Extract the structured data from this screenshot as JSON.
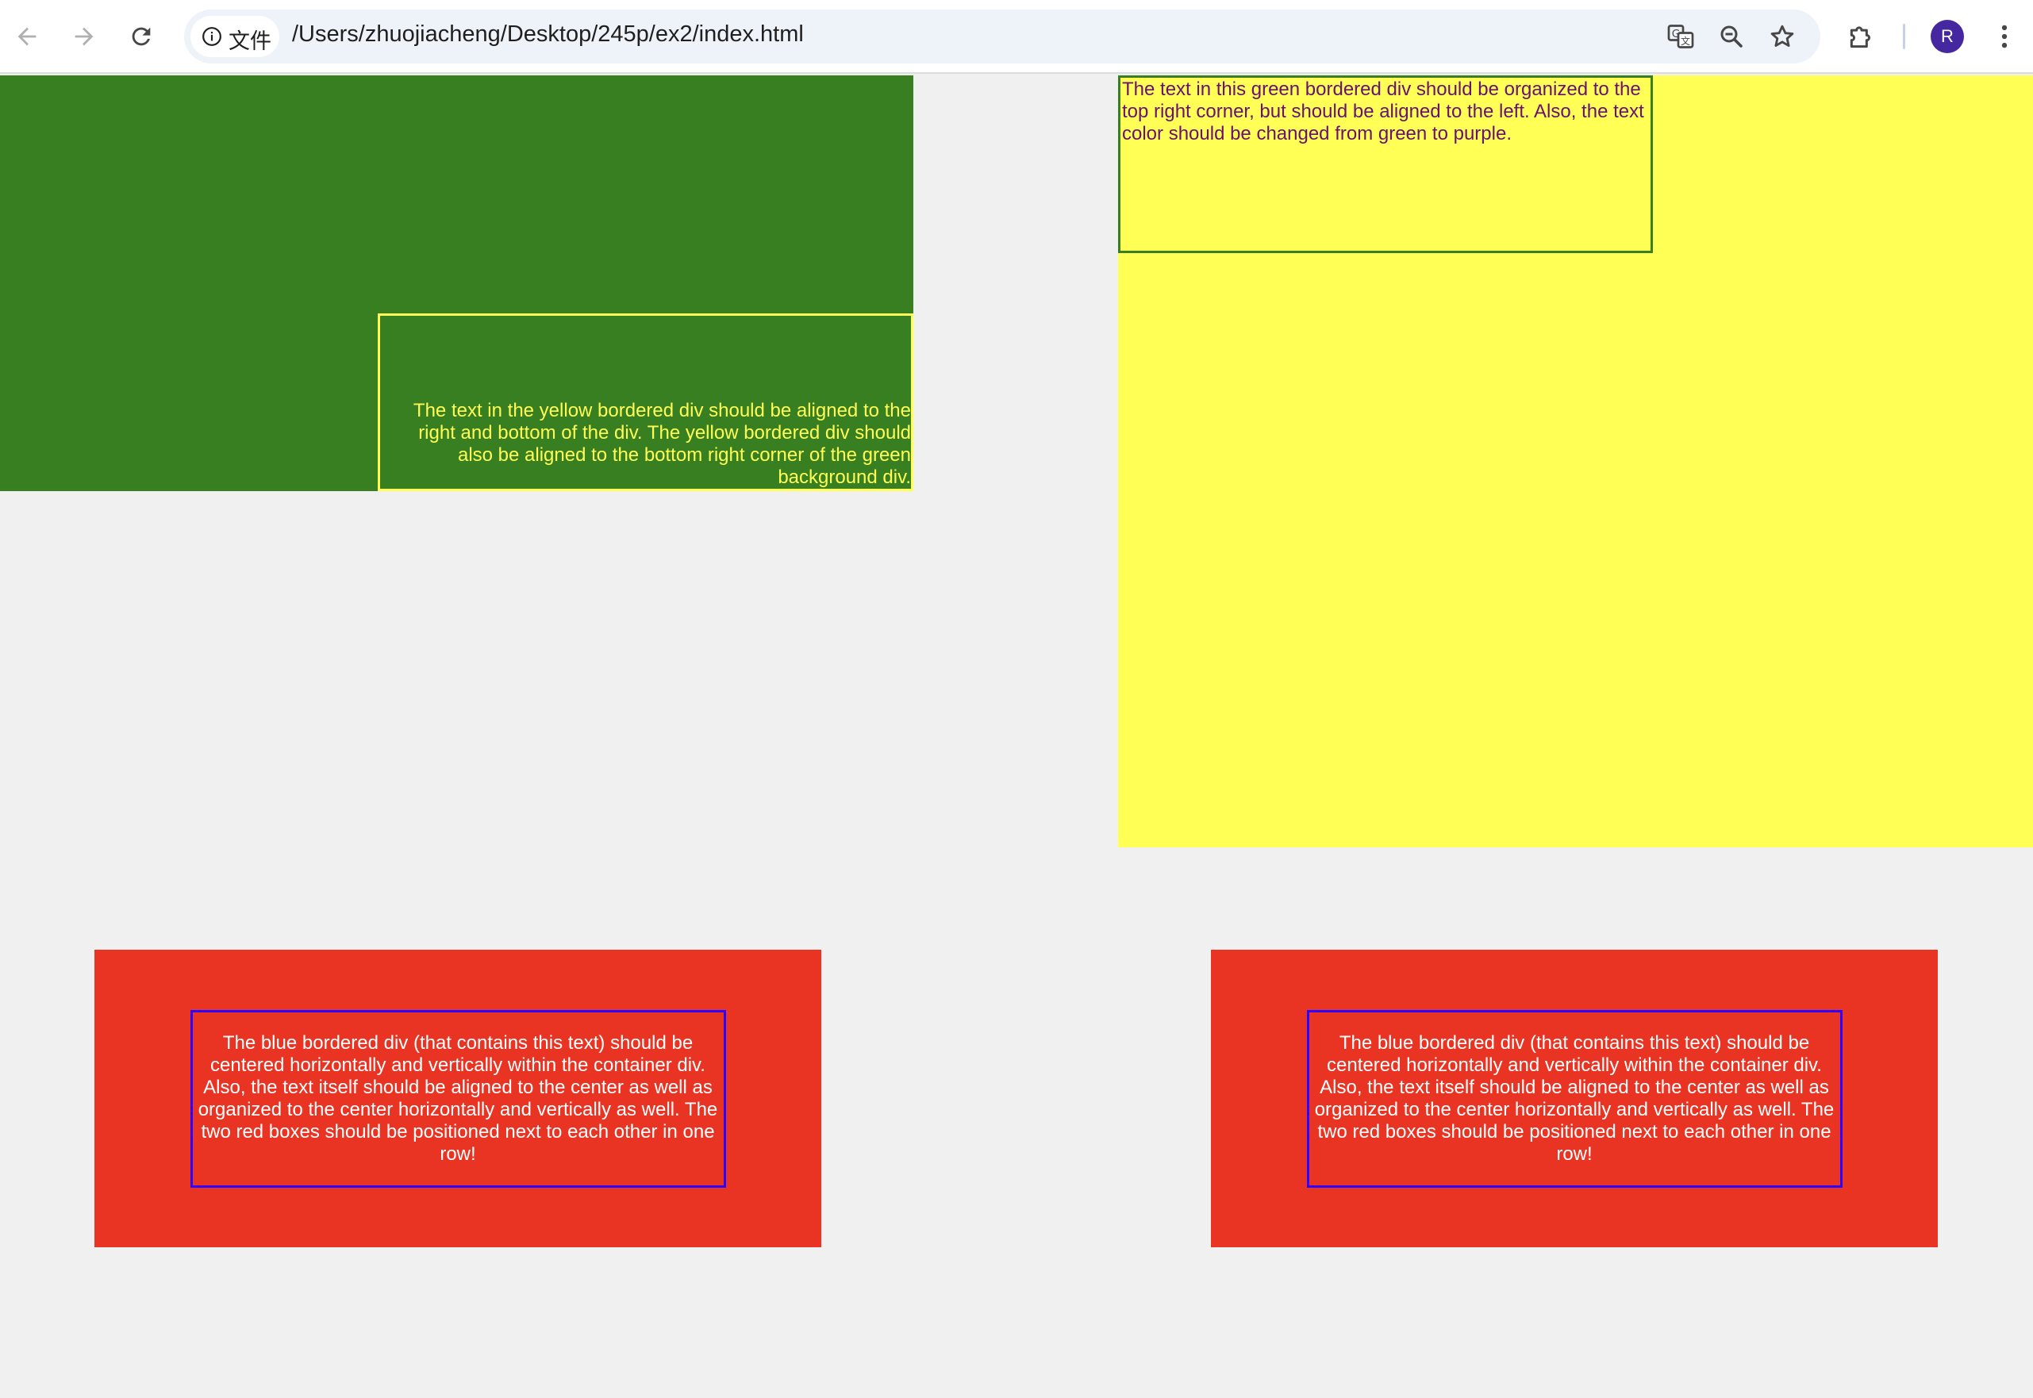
{
  "browser": {
    "site_info_label": "文件",
    "url": "/Users/zhuojiacheng/Desktop/245p/ex2/index.html",
    "profile_initial": "R",
    "icons": {
      "back": "arrow-left-icon",
      "forward": "arrow-right-icon",
      "reload": "reload-icon",
      "info": "info-icon",
      "translate": "translate-icon",
      "zoom": "zoom-out-icon",
      "bookmark": "star-icon",
      "extensions": "puzzle-icon",
      "menu": "kebab-menu-icon"
    }
  },
  "page": {
    "yellow_bordered_text": "The text in the yellow bordered div should be aligned to the right and bottom of the div. The yellow bordered div should also be aligned to the bottom right corner of the green background div.",
    "green_bordered_text": "The text in this green bordered div should be organized to the top right corner, but should be aligned to the left. Also, the text color should be changed from green to purple.",
    "blue_bordered_left_text": "The blue bordered div (that contains this text) should be centered horizontally and vertically within the container div. Also, the text itself should be aligned to the center as well as organized to the center horizontally and vertically as well. The two red boxes should be positioned next to each other in one row!",
    "blue_bordered_right_text": "The blue bordered div (that contains this text) should be centered horizontally and vertically within the container div. Also, the text itself should be aligned to the center as well as organized to the center horizontally and vertically as well. The two red boxes should be positioned next to each other in one row!"
  },
  "colors": {
    "green": "#387f22",
    "yellow": "#ffff55",
    "purple_text": "#6a1071",
    "red": "#e93423",
    "blue_border": "#2e00ff",
    "page_bg": "#f0f0f0"
  }
}
